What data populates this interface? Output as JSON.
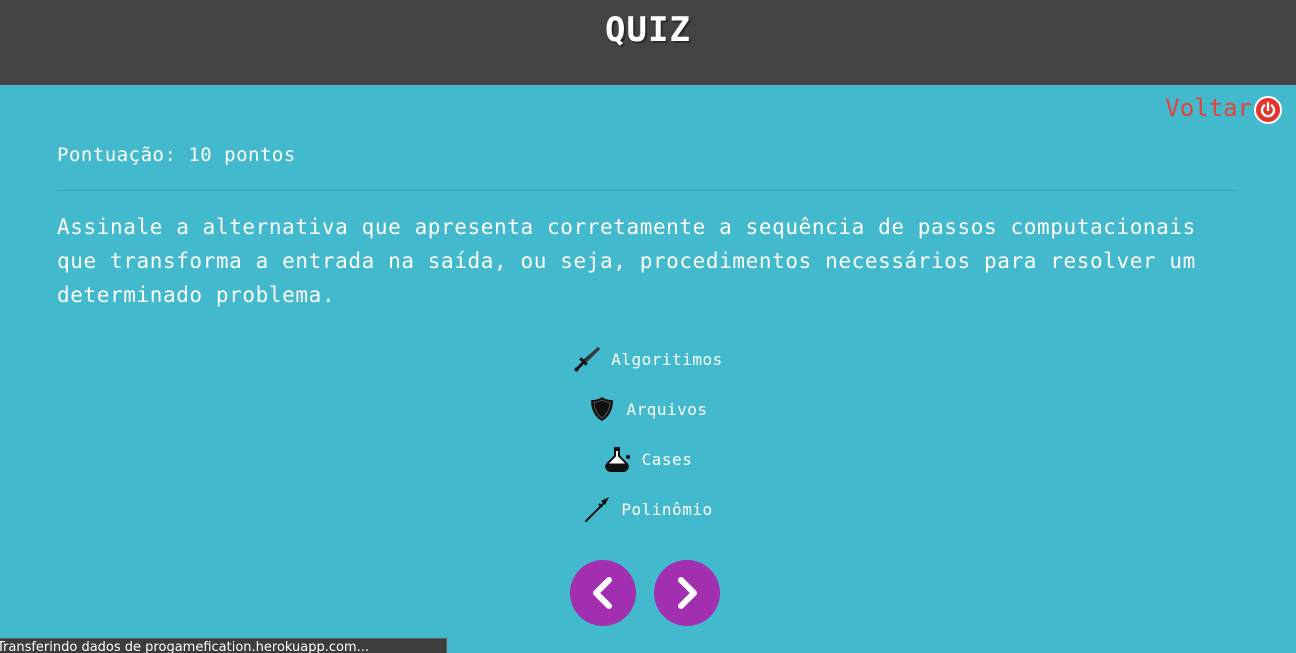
{
  "header": {
    "title": "QUIZ"
  },
  "back": {
    "label": "Voltar",
    "icon": "power-icon",
    "color": "#e8413c"
  },
  "score": {
    "text": "Pontuação: 10 pontos"
  },
  "question": {
    "text": "Assinale a alternativa que apresenta corretamente a sequência de passos computacionais que transforma a entrada na saída, ou seja, procedimentos necessários para resolver um determinado problema."
  },
  "options": [
    {
      "label": "Algoritimos",
      "icon": "sword-icon"
    },
    {
      "label": "Arquivos",
      "icon": "shield-icon"
    },
    {
      "label": "Cases",
      "icon": "potion-icon"
    },
    {
      "label": "Polinômio",
      "icon": "spear-icon"
    }
  ],
  "nav": {
    "prev_icon": "chevron-left-icon",
    "next_icon": "chevron-right-icon",
    "color": "#a12fb0"
  },
  "status_bar": {
    "text": "Transferindo dados de progamefication.herokuapp.com..."
  },
  "colors": {
    "background": "#42b9cc",
    "header": "#434343"
  }
}
